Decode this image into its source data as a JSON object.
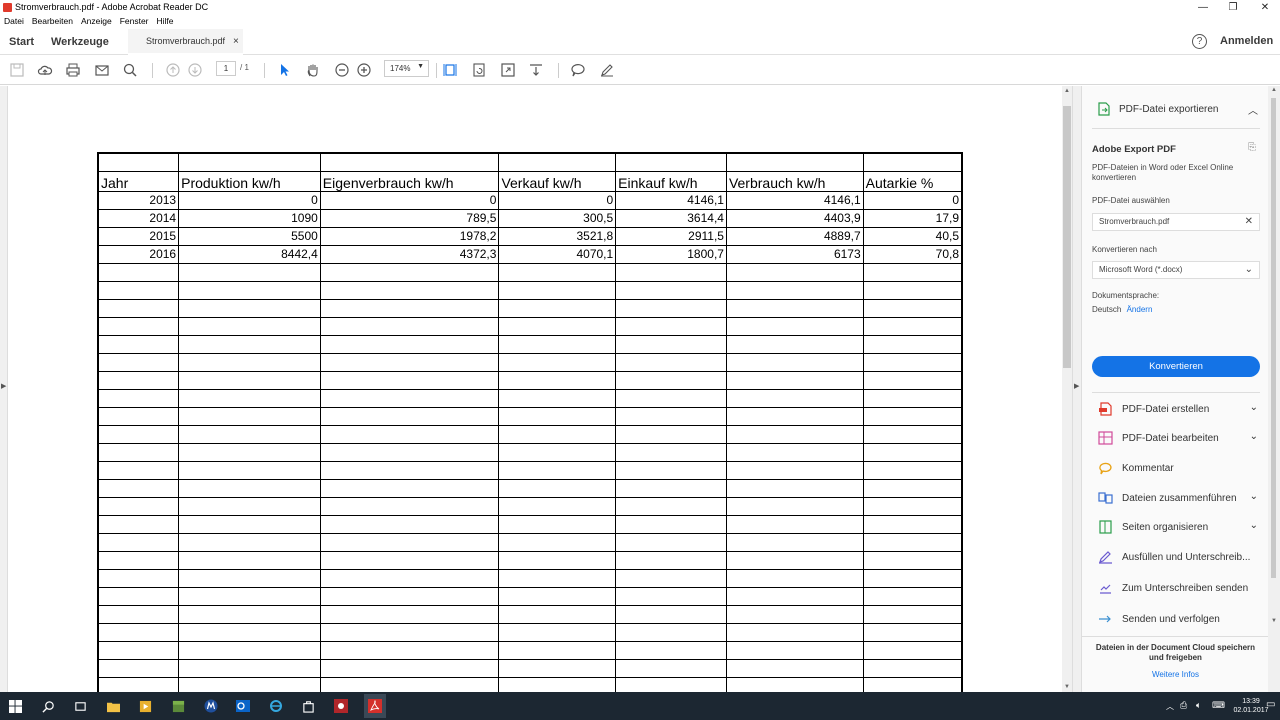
{
  "window": {
    "title": "Stromverbrauch.pdf - Adobe Acrobat Reader DC"
  },
  "menu": [
    "Datei",
    "Bearbeiten",
    "Anzeige",
    "Fenster",
    "Hilfe"
  ],
  "tabs": {
    "start": "Start",
    "tools": "Werkzeuge",
    "document": "Stromverbrauch.pdf",
    "close": "×"
  },
  "header": {
    "help": "?",
    "signin": "Anmelden"
  },
  "toolbar": {
    "page_current": "1",
    "page_total": "/ 1",
    "zoom": "174%"
  },
  "table": {
    "headers": [
      "Jahr",
      "Produktion kw/h",
      "Eigenverbrauch kw/h",
      "Verkauf kw/h",
      "Einkauf kw/h",
      "Verbrauch kw/h",
      "Autarkie %"
    ],
    "rows": [
      [
        "2013",
        "0",
        "0",
        "0",
        "4146,1",
        "4146,1",
        "0"
      ],
      [
        "2014",
        "1090",
        "789,5",
        "300,5",
        "3614,4",
        "4403,9",
        "17,9"
      ],
      [
        "2015",
        "5500",
        "1978,2",
        "3521,8",
        "2911,5",
        "4889,7",
        "40,5"
      ],
      [
        "2016",
        "8442,4",
        "4372,3",
        "4070,1",
        "1800,7",
        "6173",
        "70,8"
      ]
    ]
  },
  "panel": {
    "export_heading": "PDF-Datei exportieren",
    "export_title": "Adobe Export PDF",
    "export_desc": "PDF-Dateien in Word oder Excel Online konvertieren",
    "select_link": "PDF-Datei auswählen",
    "selected_file": "Stromverbrauch.pdf",
    "convert_to_label": "Konvertieren nach",
    "convert_to_value": "Microsoft Word (*.docx)",
    "lang_label": "Dokumentsprache:",
    "lang_value": "Deutsch",
    "lang_change": "Ändern",
    "convert_button": "Konvertieren",
    "tools": [
      "PDF-Datei erstellen",
      "PDF-Datei bearbeiten",
      "Kommentar",
      "Dateien zusammenführen",
      "Seiten organisieren",
      "Ausfüllen und Unterschreib...",
      "Zum Unterschreiben senden",
      "Senden und verfolgen"
    ],
    "footer_text": "Dateien in der Document Cloud speichern und freigeben",
    "footer_link": "Weitere Infos"
  },
  "taskbar": {
    "time": "13:39",
    "date": "02.01.2017"
  },
  "colors": {
    "accent": "#1473e6",
    "taskbar": "#1c2732",
    "acrobat_red": "#e03a2c"
  }
}
